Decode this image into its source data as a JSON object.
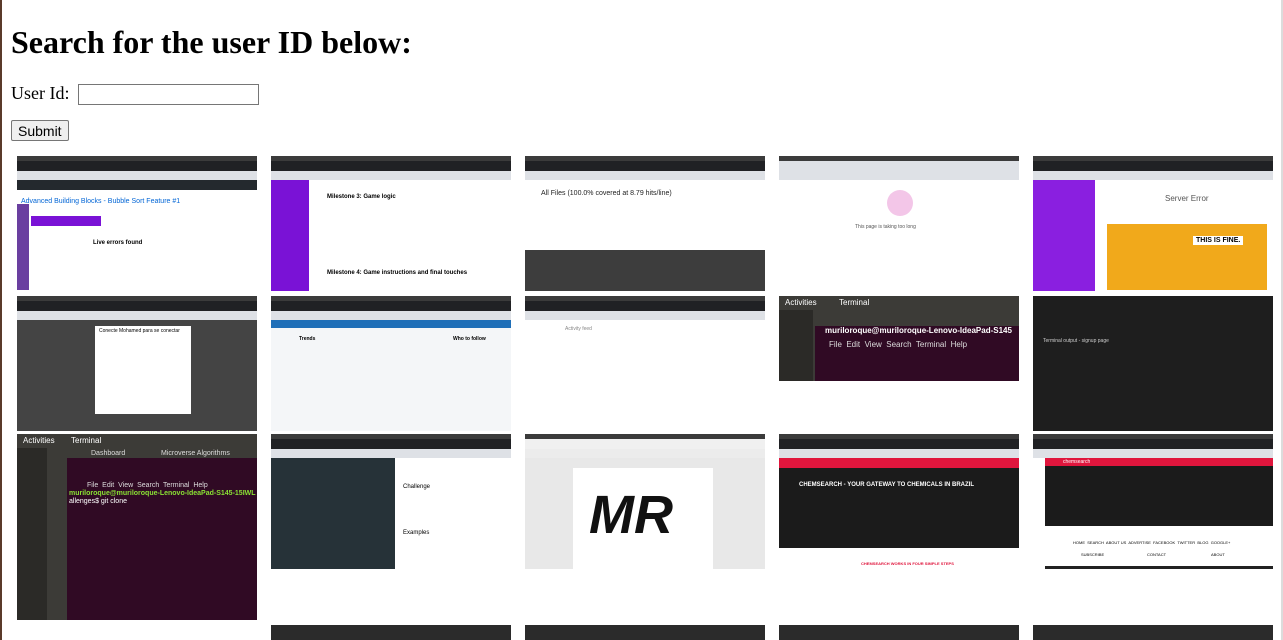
{
  "page": {
    "title": "Search for the user ID below:"
  },
  "form": {
    "label": "User Id:",
    "input_value": "",
    "submit_label": "Submit"
  },
  "thumbnails": [
    {
      "title": "Advanced Building Blocks - Bubble Sort Feature #1",
      "subtitle": "Live errors found"
    },
    {
      "title": "Milestone 3: Game logic",
      "subtitle": "Milestone 4: Game instructions and final touches"
    },
    {
      "title": "All Files (100.0% covered at 8.79 hits/line)"
    },
    {
      "title": "This page is taking too long"
    },
    {
      "title": "Server Error",
      "caption": "THIS IS FINE."
    },
    {
      "title": "Conecte Mohamed para se conectar"
    },
    {
      "title": "Trends",
      "subtitle": "Who to follow"
    },
    {
      "title": "Activity feed"
    },
    {
      "header": "Activities",
      "app": "Terminal",
      "prompt": "muriloroque@muriloroque-Lenovo-IdeaPad-S145",
      "menu": [
        "File",
        "Edit",
        "View",
        "Search",
        "Terminal",
        "Help"
      ]
    },
    {
      "title": "Terminal output - signup page"
    },
    {
      "header": "Activities",
      "app": "Terminal",
      "tab1": "Dashboard",
      "tab2": "Microverse Algorithms",
      "prompt": "muriloroque@muriloroque-Lenovo-IdeaPad-S145-15IWL",
      "command": "allenges$ git clone ",
      "menu": [
        "File",
        "Edit",
        "View",
        "Search",
        "Terminal",
        "Help"
      ]
    },
    {
      "title": "Challenge",
      "subtitle": "Examples"
    },
    {
      "title": "MR"
    },
    {
      "title": "CHEMSEARCH - YOUR GATEWAY TO CHEMICALS IN BRAZIL",
      "footer": "CHEMSEARCH WORKS IN FOUR SIMPLE STEPS"
    },
    {
      "title": "chemsearch",
      "nav": [
        "HOME",
        "SEARCH",
        "ABOUT US",
        "ADVERTISE",
        "FACEBOOK",
        "TWITTER",
        "BLOG",
        "GOOGLE+"
      ],
      "cols": [
        "SUBSCRIBE",
        "CONTACT",
        "ABOUT"
      ]
    }
  ],
  "colors": {
    "accent_purple": "#7a12d6",
    "chem_red": "#e0163d",
    "terminal_purple": "#300a24"
  }
}
